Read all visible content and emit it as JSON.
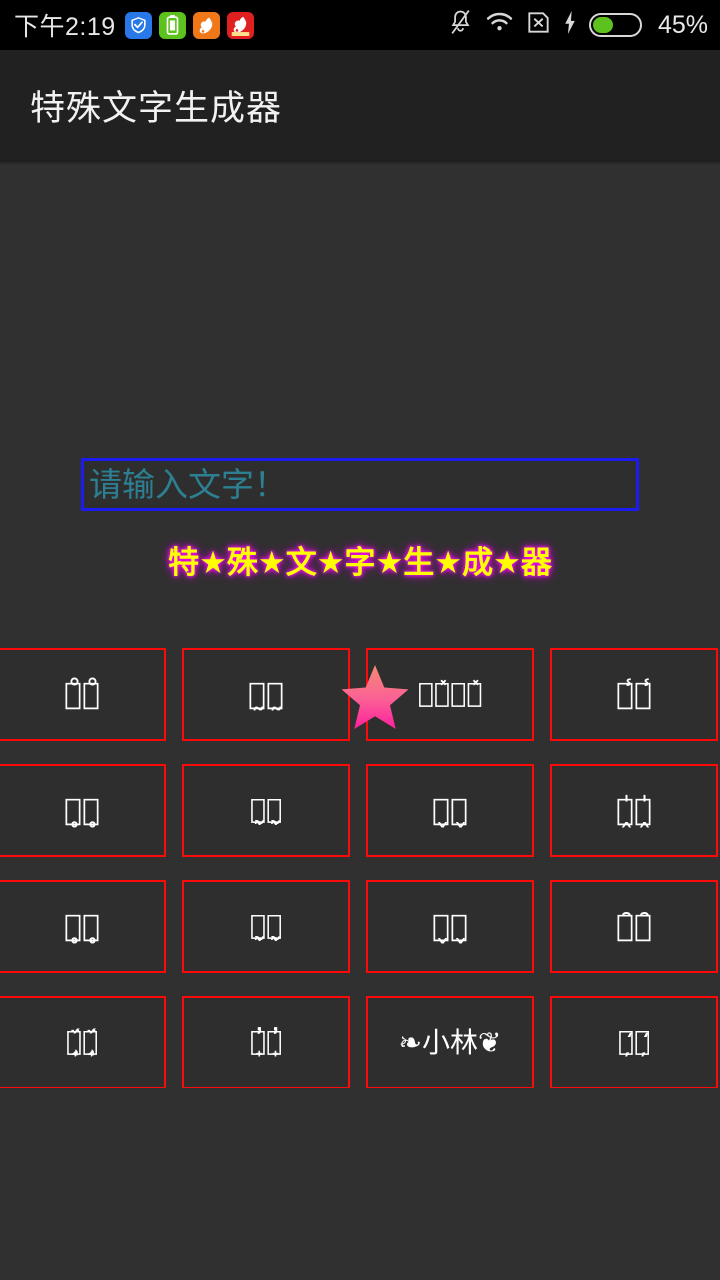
{
  "status_bar": {
    "clock": "下午2:19",
    "battery_percent": "45%",
    "battery_level": 45,
    "left_icons": [
      {
        "name": "shield-app-icon",
        "color": "#2878e8"
      },
      {
        "name": "battery-app-icon",
        "color": "#5ec21e"
      },
      {
        "name": "uc-browser-orange-icon",
        "color": "#f07818"
      },
      {
        "name": "uc-browser-red-icon",
        "color": "#e02020"
      }
    ],
    "right_icons": [
      {
        "name": "bell-muted-icon"
      },
      {
        "name": "wifi-icon"
      },
      {
        "name": "sim-card-missing-icon"
      },
      {
        "name": "charging-bolt-icon"
      }
    ]
  },
  "header": {
    "title": "特殊文字生成器"
  },
  "input": {
    "value": "",
    "placeholder": "请输入文字！"
  },
  "preview": {
    "text": "特★殊★文★字★生★成★器",
    "color": "#ffff00",
    "glow": "#ff00ff"
  },
  "overlay": {
    "star": {
      "name": "pink-star-icon",
      "color_top": "#f5836f",
      "color_bottom": "#ff2f9e"
    }
  },
  "results_grid": {
    "columns": 4,
    "border_color": "#ff0a0a",
    "cells": [
      {
        "id": "cell-1",
        "text": "小̊林̊",
        "style": "normal"
      },
      {
        "id": "cell-2",
        "text": "小̰林̰",
        "style": "normal"
      },
      {
        "id": "cell-3",
        "text": "小͛̽林͛̽",
        "style": "small"
      },
      {
        "id": "cell-4",
        "text": "小̾林̾",
        "style": "normal"
      },
      {
        "id": "cell-5",
        "text": "小̥林̥",
        "style": "normal"
      },
      {
        "id": "cell-6",
        "text": "小̖̰林̖̰",
        "style": "small"
      },
      {
        "id": "cell-7",
        "text": "小̬林̬",
        "style": "normal"
      },
      {
        "id": "cell-8",
        "text": "小̭̍林̭̍",
        "style": "normal"
      },
      {
        "id": "cell-9",
        "text": "小̥林̥",
        "style": "normal"
      },
      {
        "id": "cell-10",
        "text": "小̖̰林̖̰",
        "style": "small"
      },
      {
        "id": "cell-11",
        "text": "小̬林̬",
        "style": "normal"
      },
      {
        "id": "cell-12",
        "text": "小̑林̑",
        "style": "normal"
      },
      {
        "id": "cell-13",
        "text": "小̧͎̈́ͅ林̧͎̈́ͅ",
        "style": "small"
      },
      {
        "id": "cell-14",
        "text": "小̟̓林̟̓",
        "style": "small"
      },
      {
        "id": "cell-15",
        "text": "❧小林❦",
        "style": "orn"
      },
      {
        "id": "cell-16",
        "text": "小̦̒林̦̒",
        "style": "small"
      }
    ]
  }
}
